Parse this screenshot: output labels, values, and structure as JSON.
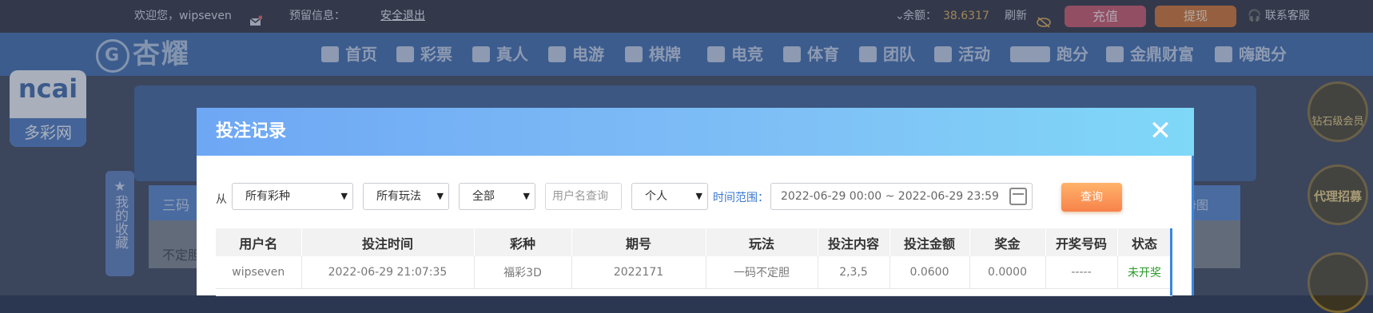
{
  "topbar": {
    "welcome": "欢迎您，wipseven",
    "reserved_info_label": "预留信息：",
    "logout_label": "安全退出",
    "balance_label": "余额：",
    "balance_value": "38.6317",
    "refresh_label": "刷新",
    "recharge_label": "充值",
    "withdraw_label": "提现",
    "service_label": "联系客服"
  },
  "nav": {
    "logo_text": "杏耀",
    "items": [
      "首页",
      "彩票",
      "真人",
      "电游",
      "棋牌",
      "电竞",
      "体育",
      "团队",
      "活动",
      "跑分",
      "金鼎财富",
      "嗨跑分"
    ]
  },
  "background": {
    "ad_brand": "ncai",
    "ad_sub": "多彩网",
    "favorites": "我的收藏",
    "row_text_1": "三码",
    "row_text_2": "不定胆",
    "chart_label": "势图",
    "badge_1": "钻石级会员",
    "badge_2": "代理招募"
  },
  "modal": {
    "title": "投注记录",
    "close_icon": "close-icon",
    "filters": {
      "from_label": "从",
      "lottery_select": "所有彩种",
      "play_select": "所有玩法",
      "status_select": "全部",
      "username_placeholder": "用户名查询",
      "scope_select": "个人",
      "time_range_label": "时间范围：",
      "time_range_value": "2022-06-29 00:00 ~ 2022-06-29 23:59",
      "query_button": "查询"
    },
    "table": {
      "headers": [
        "用户名",
        "投注时间",
        "彩种",
        "期号",
        "玩法",
        "投注内容",
        "投注金额",
        "奖金",
        "开奖号码",
        "状态"
      ],
      "rows": [
        [
          "wipseven",
          "2022-06-29 21:07:35",
          "福彩3D",
          "2022171",
          "一码不定胆",
          "2,3,5",
          "0.0600",
          "0.0000",
          "-----",
          "未开奖"
        ]
      ]
    }
  },
  "colors": {
    "topbar_bg": "#1e2232",
    "navbar_bg": "#2e5ea6",
    "balance": "#d9a347",
    "recharge": "#c2455c",
    "withdraw": "#c8651f",
    "modal_header": "#7fc0f6",
    "query_button": "#f7824a",
    "status_pending": "#2a9a2a"
  }
}
